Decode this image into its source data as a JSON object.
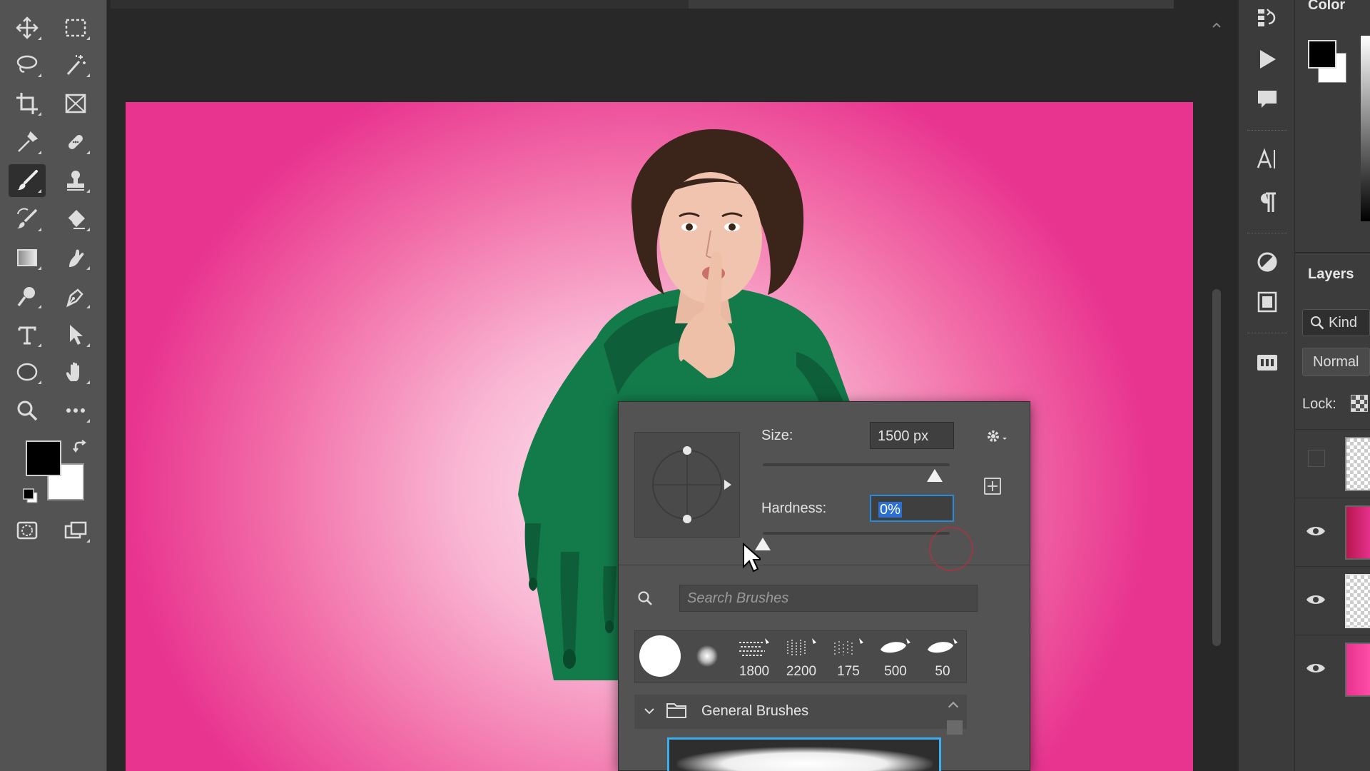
{
  "toolbar": {
    "tools": [
      {
        "name": "move-tool",
        "icon": "move-icon"
      },
      {
        "name": "rectangular-marquee-tool",
        "icon": "marquee-icon"
      },
      {
        "name": "lasso-tool",
        "icon": "lasso-icon"
      },
      {
        "name": "magic-wand-tool",
        "icon": "magic-wand-icon"
      },
      {
        "name": "crop-tool",
        "icon": "crop-icon"
      },
      {
        "name": "frame-tool",
        "icon": "frame-icon"
      },
      {
        "name": "eyedropper-tool",
        "icon": "eyedropper-icon"
      },
      {
        "name": "spot-healing-tool",
        "icon": "bandage-icon"
      },
      {
        "name": "brush-tool",
        "icon": "brush-icon",
        "active": true
      },
      {
        "name": "clone-stamp-tool",
        "icon": "stamp-icon"
      },
      {
        "name": "history-brush-tool",
        "icon": "history-brush-icon"
      },
      {
        "name": "eraser-tool",
        "icon": "eraser-icon"
      },
      {
        "name": "gradient-tool",
        "icon": "gradient-icon"
      },
      {
        "name": "smudge-tool",
        "icon": "smudge-icon"
      },
      {
        "name": "dodge-tool",
        "icon": "dodge-icon"
      },
      {
        "name": "pen-tool",
        "icon": "pen-icon"
      },
      {
        "name": "type-tool",
        "icon": "type-icon"
      },
      {
        "name": "path-selection-tool",
        "icon": "arrow-icon"
      },
      {
        "name": "ellipse-tool",
        "icon": "ellipse-icon"
      },
      {
        "name": "hand-tool",
        "icon": "hand-icon"
      },
      {
        "name": "zoom-tool",
        "icon": "zoom-icon"
      },
      {
        "name": "more-tools",
        "icon": "ellipsis-icon"
      }
    ],
    "foreground_color": "#000000",
    "background_color": "#ffffff"
  },
  "icon_strip": [
    "history-icon",
    "play-icon",
    "comment-icon",
    "character-icon",
    "paragraph-icon",
    "adjustments-icon",
    "libraries-icon",
    "channels-icon"
  ],
  "panels": {
    "color": {
      "title": "Color"
    },
    "layers": {
      "title": "Layers",
      "filter_label": "Kind",
      "blend_mode": "Normal",
      "lock_label": "Lock:"
    }
  },
  "brush_popup": {
    "size_label": "Size:",
    "size_value": "1500 px",
    "size_fraction": 0.92,
    "hardness_label": "Hardness:",
    "hardness_value": "0%",
    "hardness_fraction": 0.0,
    "search_placeholder": "Search Brushes",
    "presets": [
      "",
      "",
      "1800",
      "2200",
      "175",
      "500",
      "50"
    ],
    "group_label": "General Brushes"
  },
  "colors": {
    "accent": "#2b8ad8",
    "canvas_edge": "#e8338f",
    "canvas_center": "#fde6ef",
    "hoodie": "#137a4a"
  }
}
